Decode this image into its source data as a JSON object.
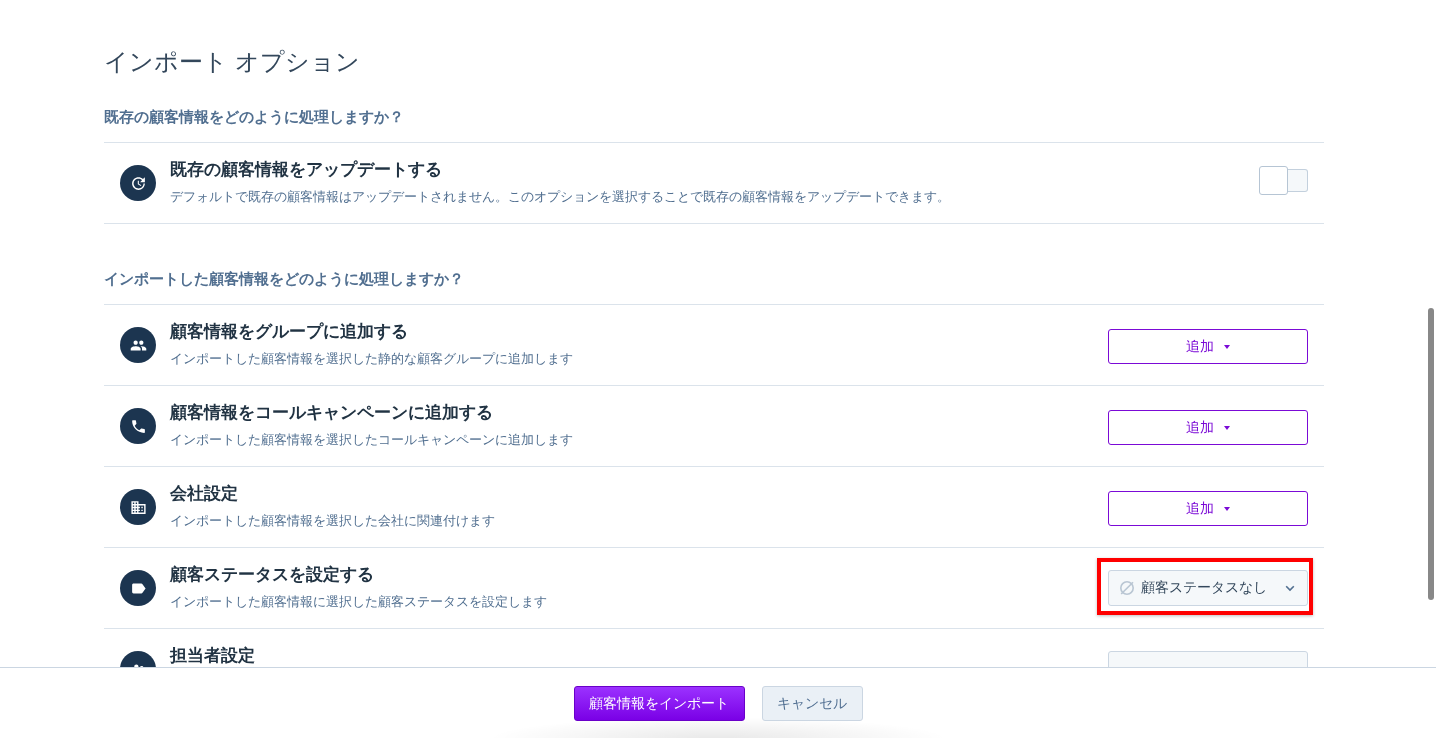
{
  "page_title": "インポート オプション",
  "sections": [
    {
      "heading": "既存の顧客情報をどのように処理しますか？",
      "options": [
        {
          "kind": "toggle",
          "title": "既存の顧客情報をアップデートする",
          "description": "デフォルトで既存の顧客情報はアップデートされません。このオプションを選択することで既存の顧客情報をアップデートできます。",
          "on": false,
          "highlighted": false
        }
      ]
    },
    {
      "heading": "インポートした顧客情報をどのように処理しますか？",
      "options": [
        {
          "kind": "menu_button",
          "title": "顧客情報をグループに追加する",
          "description": "インポートした顧客情報を選択した静的な顧客グループに追加します",
          "button": "追加",
          "highlighted": false
        },
        {
          "kind": "menu_button",
          "title": "顧客情報をコールキャンペーンに追加する",
          "description": "インポートした顧客情報を選択したコールキャンペーンに追加します",
          "button": "追加",
          "highlighted": false
        },
        {
          "kind": "menu_button",
          "title": "会社設定",
          "description": "インポートした顧客情報を選択した会社に関連付けます",
          "button": "追加",
          "highlighted": false
        },
        {
          "kind": "select",
          "title": "顧客ステータスを設定する",
          "description": "インポートした顧客情報に選択した顧客ステータスを設定します",
          "value": "顧客ステータスなし",
          "highlighted": true
        },
        {
          "kind": "select",
          "title": "担当者設定",
          "highlighted": false
        }
      ]
    }
  ],
  "footer": {
    "buttons": [
      {
        "label": "顧客情報をインポート",
        "kind": "primary"
      },
      {
        "label": "キャンセル",
        "kind": "secondary"
      }
    ]
  }
}
